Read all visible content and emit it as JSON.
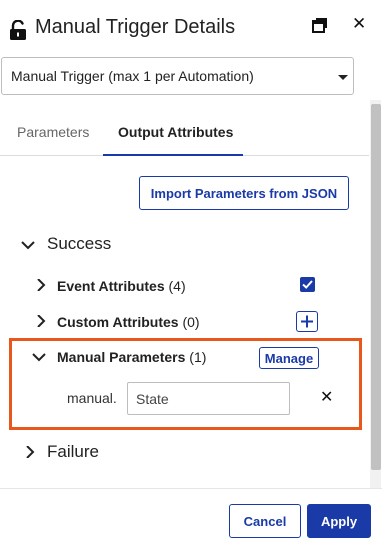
{
  "header": {
    "title": "Manual Trigger Details",
    "lock_icon": "unlocked-padlock-icon",
    "popout_icon": "popout-window-icon",
    "close_glyph": "✕"
  },
  "trigger_select": {
    "value": "Manual Trigger (max 1 per Automation)"
  },
  "tabs": [
    {
      "label": "Parameters",
      "active": false
    },
    {
      "label": "Output Attributes",
      "active": true
    }
  ],
  "import_button": {
    "label": "Import Parameters from JSON"
  },
  "tree": {
    "success": {
      "label": "Success",
      "expanded": true,
      "groups": [
        {
          "label": "Event Attributes",
          "count": "(4)",
          "expanded": false,
          "checked": true
        },
        {
          "label": "Custom Attributes",
          "count": "(0)",
          "expanded": false,
          "add_icon": "plus-icon"
        },
        {
          "label": "Manual Parameters",
          "count": "(1)",
          "expanded": true,
          "manage_label": "Manage",
          "parameters": [
            {
              "prefix": "manual.",
              "value": "State",
              "remove_glyph": "✕"
            }
          ]
        }
      ]
    },
    "failure": {
      "label": "Failure",
      "expanded": false
    }
  },
  "footer": {
    "cancel_label": "Cancel",
    "apply_label": "Apply"
  },
  "colors": {
    "accent": "#1a3aa8",
    "highlight": "#e8581c",
    "border": "#bdbdbd"
  }
}
